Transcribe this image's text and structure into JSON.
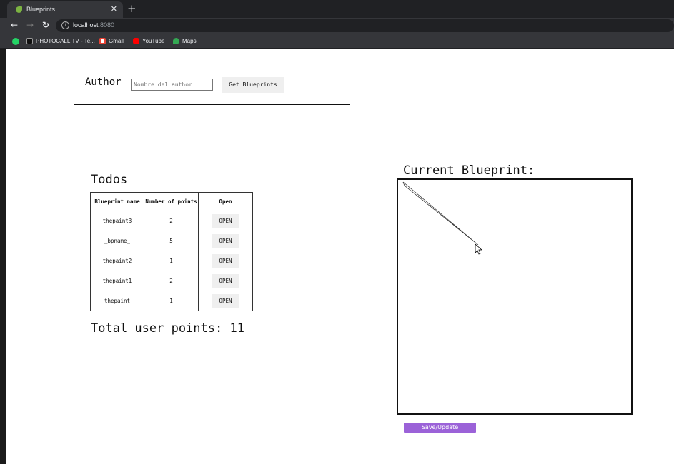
{
  "browser": {
    "tab_title": "Blueprints",
    "tab_close": "✕",
    "new_tab": "+",
    "url_host": "localhost",
    "url_port": ":8080",
    "bookmarks": [
      {
        "label": "PHOTOCALL.TV - Te...",
        "icon": "tv-icon",
        "color": "#333333"
      },
      {
        "label": "Gmail",
        "icon": "gmail-icon",
        "color": "#ea4335"
      },
      {
        "label": "YouTube",
        "icon": "youtube-icon",
        "color": "#ff0000"
      },
      {
        "label": "Maps",
        "icon": "maps-icon",
        "color": "#34a853"
      }
    ]
  },
  "author": {
    "label": "Author",
    "placeholder": "Nombre del author",
    "value": "",
    "button": "Get Blueprints"
  },
  "list": {
    "title": "Todos",
    "columns": [
      "Blueprint name",
      "Number of points",
      "Open"
    ],
    "rows": [
      {
        "name": "thepaint3",
        "points": "2",
        "open": "OPEN"
      },
      {
        "name": "_bpname_",
        "points": "5",
        "open": "OPEN"
      },
      {
        "name": "thepaint2",
        "points": "1",
        "open": "OPEN"
      },
      {
        "name": "thepaint1",
        "points": "2",
        "open": "OPEN"
      },
      {
        "name": "thepaint",
        "points": "1",
        "open": "OPEN"
      }
    ],
    "total": "Total user points: 11"
  },
  "blueprint": {
    "title": "Current Blueprint:",
    "save_button": "Save/Update"
  },
  "colors": {
    "accent": "#9b62d8",
    "chrome_dark": "#202124",
    "chrome": "#35363a"
  }
}
